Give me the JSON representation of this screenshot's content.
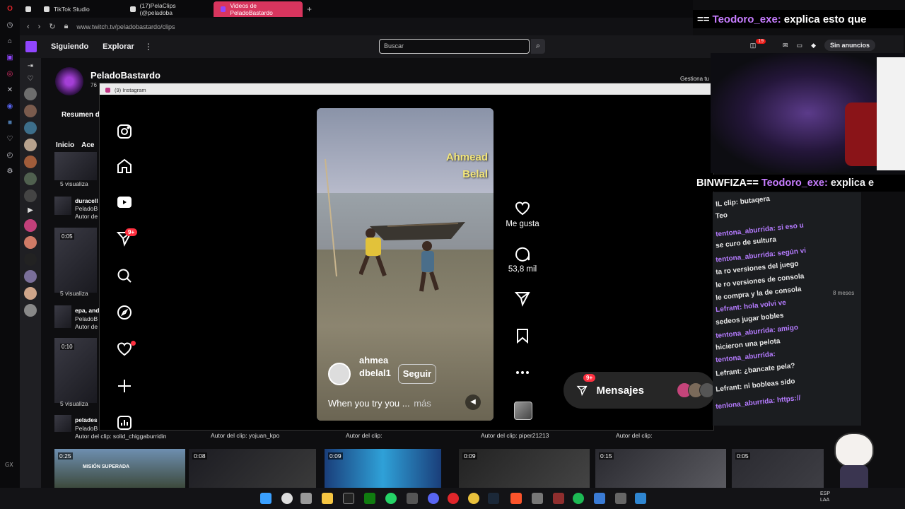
{
  "browser": {
    "tabs": [
      {
        "label": "TikTok Studio"
      },
      {
        "label": "(17)PelaClips (@peladoba"
      },
      {
        "label": "Videos de PeladoBastardo"
      }
    ],
    "url": "www.twitch.tv/peladobastardo/clips",
    "gx_label": "GX"
  },
  "stream_overlay": {
    "chat_banner_prefix": "==",
    "chat_banner_user": "Teodoro_exe:",
    "chat_banner_msg": "explica esto que",
    "chat_banner2_prefix": "BINWFIZA==",
    "chat_banner2_user": "Teodoro_exe:",
    "chat_banner2_msg": "explica e",
    "chat_lines": [
      "IL clip: butaqera",
      "Teo",
      "tentona_aburrida: si eso u",
      "se curo de sultura",
      "tentona_aburrida: según vi",
      "ta ro versiones del juego",
      "le ro versiones de consola",
      "le compra y la de consola",
      "Lefrant: hola volvi ve",
      "sedeos jugar bobles",
      "tentona_aburrida: amigo",
      "hicieron una pelota",
      "tentona_aburrida:",
      "Lefrant: ¿bancate pela?",
      "Lefrant: ni bobleas sido",
      "tenlona_aburrida: https://"
    ],
    "chat_time": "8 meses"
  },
  "twitch": {
    "nav": {
      "following": "Siguiendo",
      "explore": "Explorar",
      "search_placeholder": "Buscar",
      "notif_count": "19",
      "no_ads": "Sin anuncios"
    },
    "channel_name": "PeladoBastardo",
    "channel_followers": "76",
    "manage_sub": "Gestiona tu suscripción",
    "summary": "Resumen d",
    "tabs": [
      "Inicio",
      "Ace"
    ],
    "clips_left": [
      {
        "views": "5 visualiza"
      },
      {
        "title": "duracell",
        "channel": "PeladoB",
        "author": "Autor de"
      },
      {
        "duration": "0:05"
      },
      {
        "views": "5 visualiza"
      },
      {
        "title": "epa, and",
        "channel": "PeladoB",
        "author": "Autor de"
      },
      {
        "duration": "0:10"
      },
      {
        "views": "5 visualiza"
      },
      {
        "title": "pelades",
        "channel": "PeladoB",
        "author": "Autor del clip: solid_chiggaburridin"
      }
    ],
    "bottom_authors": [
      "Autor del clip: yojuan_kpo",
      "Autor del clip:",
      "Autor del clip: piper21213",
      "Autor del clip:"
    ],
    "bottom_durations": [
      "0:25",
      "0:08",
      "0:09",
      "0:09",
      "0:15",
      "0:05"
    ],
    "bottom_thumb_text": "MISIÓN SUPERADA"
  },
  "instagram": {
    "window_title": "(9) Instagram",
    "nav_badge": "9+",
    "reel": {
      "overlay_name_line1": "Ahmead",
      "overlay_name_line2": "Belal",
      "username": "ahmeadbelal1",
      "follow_label": "Seguir",
      "description": "When you try you ...",
      "more": "más"
    },
    "actions": {
      "like_label": "Me gusta",
      "comment_count": "53,8 mil"
    },
    "messages": {
      "label": "Mensajes",
      "badge": "9+"
    }
  },
  "taskbar": {
    "lang_line1": "ESP",
    "lang_line2": "LAA"
  }
}
